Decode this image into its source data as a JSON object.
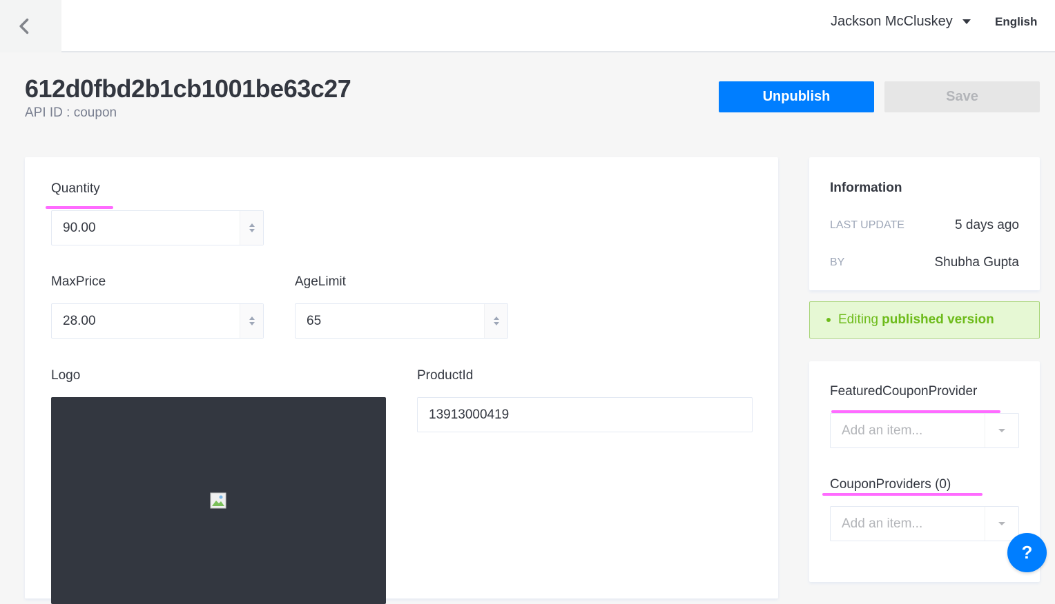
{
  "header": {
    "user_name": "Jackson McCluskey",
    "language": "English"
  },
  "page": {
    "title": "612d0fbd2b1cb1001be63c27",
    "api_id_label": "API ID : coupon"
  },
  "actions": {
    "unpublish_label": "Unpublish",
    "save_label": "Save"
  },
  "form": {
    "quantity": {
      "label": "Quantity",
      "value": "90.00"
    },
    "max_price": {
      "label": "MaxPrice",
      "value": "28.00"
    },
    "age_limit": {
      "label": "AgeLimit",
      "value": "65"
    },
    "logo": {
      "label": "Logo"
    },
    "product_id": {
      "label": "ProductId",
      "value": "13913000419"
    }
  },
  "information": {
    "title": "Information",
    "last_update_key": "LAST UPDATE",
    "last_update_value": "5 days ago",
    "by_key": "BY",
    "by_value": "Shubha Gupta"
  },
  "status_banner": {
    "prefix": "Editing",
    "bold": "published version"
  },
  "relations": {
    "featured_label": "FeaturedCouponProvider",
    "featured_placeholder": "Add an item...",
    "providers_label": "CouponProviders (0)",
    "providers_placeholder": "Add an item..."
  },
  "help": {
    "label": "?"
  },
  "colors": {
    "primary": "#007eff",
    "highlight_underline": "#ff6bff",
    "success_text": "#6dbb1a",
    "success_bg": "#e6f8d4"
  }
}
